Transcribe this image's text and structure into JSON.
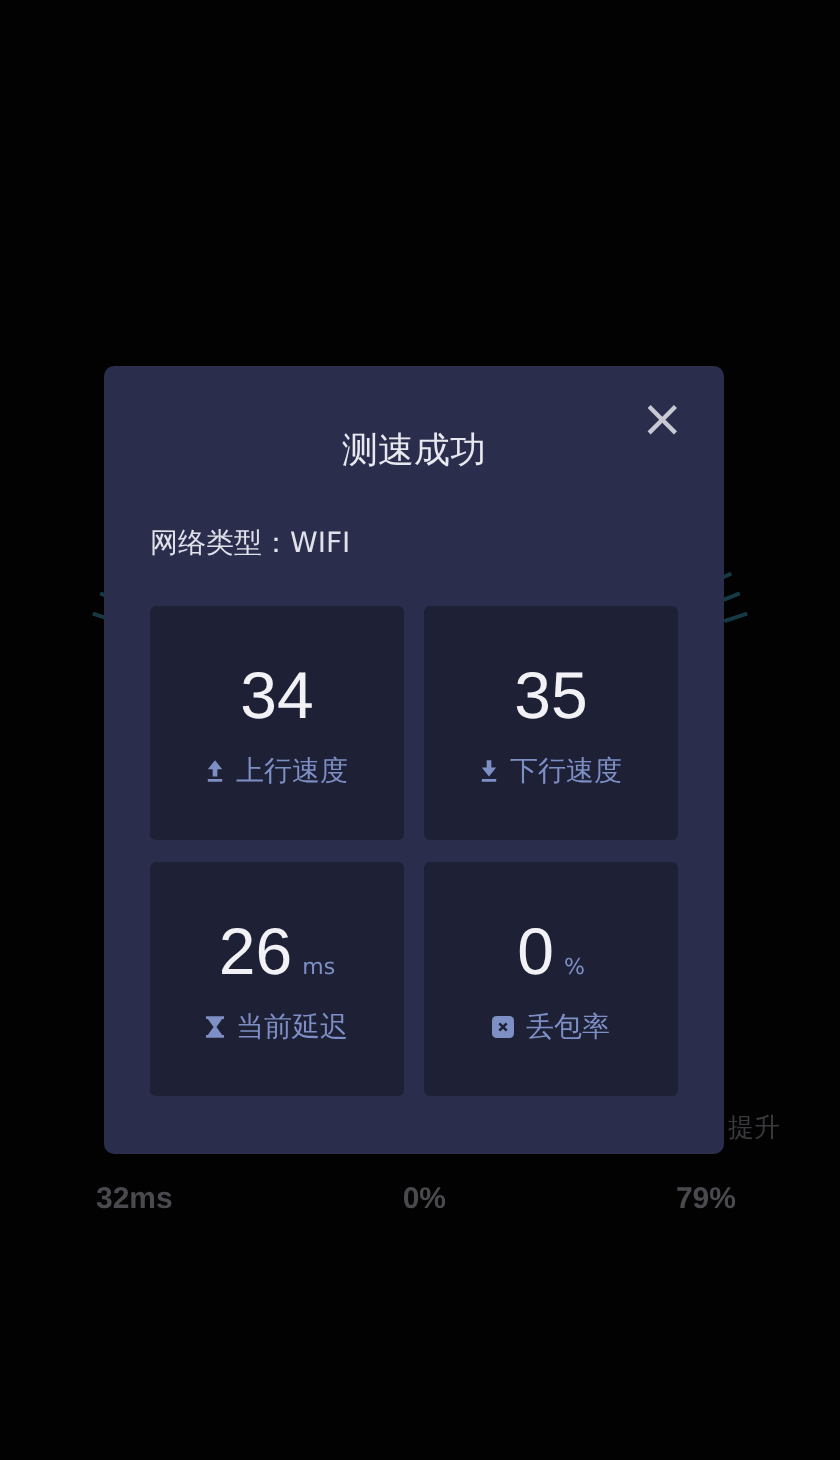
{
  "background": {
    "side_note": "提升",
    "stats": [
      "32ms",
      "0%",
      "79%"
    ]
  },
  "dialog": {
    "title": "测速成功",
    "close": "×",
    "network_type": "网络类型：WIFI",
    "cards": [
      {
        "value": "34",
        "label": "上行速度",
        "kind": "upload"
      },
      {
        "value": "35",
        "label": "下行速度",
        "kind": "download"
      },
      {
        "value": "26",
        "unit": "ms",
        "label": "当前延迟",
        "kind": "latency"
      },
      {
        "value": "0",
        "unit": "%",
        "label": "丢包率",
        "kind": "loss"
      }
    ]
  }
}
